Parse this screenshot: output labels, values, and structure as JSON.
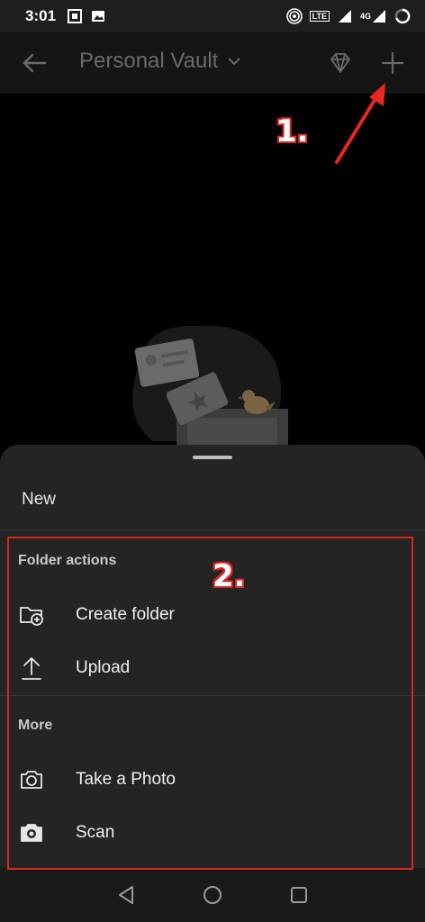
{
  "status_bar": {
    "time": "3:01",
    "network_label": "4G",
    "lte_label": "LTE"
  },
  "app_bar": {
    "title": "Personal Vault",
    "icons": [
      "back-arrow-icon",
      "chevron-down-icon",
      "diamond-icon",
      "plus-icon"
    ]
  },
  "annotations": {
    "step1": "1.",
    "step2": "2.",
    "highlight_color": "#d8271c"
  },
  "sheet": {
    "title": "New",
    "sections": [
      {
        "title": "Folder actions",
        "items": [
          {
            "label": "Create folder",
            "icon": "folder-add-icon"
          },
          {
            "label": "Upload",
            "icon": "upload-icon"
          }
        ]
      },
      {
        "title": "More",
        "items": [
          {
            "label": "Take a Photo",
            "icon": "camera-outline-icon"
          },
          {
            "label": "Scan",
            "icon": "camera-filled-icon"
          }
        ]
      }
    ]
  },
  "nav": {
    "icons": [
      "back-triangle-icon",
      "home-circle-icon",
      "recents-square-icon"
    ]
  }
}
